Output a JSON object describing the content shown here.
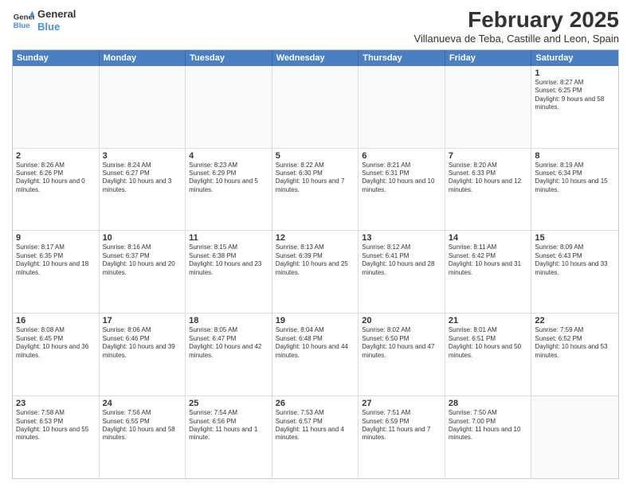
{
  "logo": {
    "line1": "General",
    "line2": "Blue"
  },
  "title": "February 2025",
  "subtitle": "Villanueva de Teba, Castille and Leon, Spain",
  "header_days": [
    "Sunday",
    "Monday",
    "Tuesday",
    "Wednesday",
    "Thursday",
    "Friday",
    "Saturday"
  ],
  "weeks": [
    [
      {
        "day": "",
        "text": ""
      },
      {
        "day": "",
        "text": ""
      },
      {
        "day": "",
        "text": ""
      },
      {
        "day": "",
        "text": ""
      },
      {
        "day": "",
        "text": ""
      },
      {
        "day": "",
        "text": ""
      },
      {
        "day": "1",
        "text": "Sunrise: 8:27 AM\nSunset: 6:25 PM\nDaylight: 9 hours and 58 minutes."
      }
    ],
    [
      {
        "day": "2",
        "text": "Sunrise: 8:26 AM\nSunset: 6:26 PM\nDaylight: 10 hours and 0 minutes."
      },
      {
        "day": "3",
        "text": "Sunrise: 8:24 AM\nSunset: 6:27 PM\nDaylight: 10 hours and 3 minutes."
      },
      {
        "day": "4",
        "text": "Sunrise: 8:23 AM\nSunset: 6:29 PM\nDaylight: 10 hours and 5 minutes."
      },
      {
        "day": "5",
        "text": "Sunrise: 8:22 AM\nSunset: 6:30 PM\nDaylight: 10 hours and 7 minutes."
      },
      {
        "day": "6",
        "text": "Sunrise: 8:21 AM\nSunset: 6:31 PM\nDaylight: 10 hours and 10 minutes."
      },
      {
        "day": "7",
        "text": "Sunrise: 8:20 AM\nSunset: 6:33 PM\nDaylight: 10 hours and 12 minutes."
      },
      {
        "day": "8",
        "text": "Sunrise: 8:19 AM\nSunset: 6:34 PM\nDaylight: 10 hours and 15 minutes."
      }
    ],
    [
      {
        "day": "9",
        "text": "Sunrise: 8:17 AM\nSunset: 6:35 PM\nDaylight: 10 hours and 18 minutes."
      },
      {
        "day": "10",
        "text": "Sunrise: 8:16 AM\nSunset: 6:37 PM\nDaylight: 10 hours and 20 minutes."
      },
      {
        "day": "11",
        "text": "Sunrise: 8:15 AM\nSunset: 6:38 PM\nDaylight: 10 hours and 23 minutes."
      },
      {
        "day": "12",
        "text": "Sunrise: 8:13 AM\nSunset: 6:39 PM\nDaylight: 10 hours and 25 minutes."
      },
      {
        "day": "13",
        "text": "Sunrise: 8:12 AM\nSunset: 6:41 PM\nDaylight: 10 hours and 28 minutes."
      },
      {
        "day": "14",
        "text": "Sunrise: 8:11 AM\nSunset: 6:42 PM\nDaylight: 10 hours and 31 minutes."
      },
      {
        "day": "15",
        "text": "Sunrise: 8:09 AM\nSunset: 6:43 PM\nDaylight: 10 hours and 33 minutes."
      }
    ],
    [
      {
        "day": "16",
        "text": "Sunrise: 8:08 AM\nSunset: 6:45 PM\nDaylight: 10 hours and 36 minutes."
      },
      {
        "day": "17",
        "text": "Sunrise: 8:06 AM\nSunset: 6:46 PM\nDaylight: 10 hours and 39 minutes."
      },
      {
        "day": "18",
        "text": "Sunrise: 8:05 AM\nSunset: 6:47 PM\nDaylight: 10 hours and 42 minutes."
      },
      {
        "day": "19",
        "text": "Sunrise: 8:04 AM\nSunset: 6:48 PM\nDaylight: 10 hours and 44 minutes."
      },
      {
        "day": "20",
        "text": "Sunrise: 8:02 AM\nSunset: 6:50 PM\nDaylight: 10 hours and 47 minutes."
      },
      {
        "day": "21",
        "text": "Sunrise: 8:01 AM\nSunset: 6:51 PM\nDaylight: 10 hours and 50 minutes."
      },
      {
        "day": "22",
        "text": "Sunrise: 7:59 AM\nSunset: 6:52 PM\nDaylight: 10 hours and 53 minutes."
      }
    ],
    [
      {
        "day": "23",
        "text": "Sunrise: 7:58 AM\nSunset: 6:53 PM\nDaylight: 10 hours and 55 minutes."
      },
      {
        "day": "24",
        "text": "Sunrise: 7:56 AM\nSunset: 6:55 PM\nDaylight: 10 hours and 58 minutes."
      },
      {
        "day": "25",
        "text": "Sunrise: 7:54 AM\nSunset: 6:56 PM\nDaylight: 11 hours and 1 minute."
      },
      {
        "day": "26",
        "text": "Sunrise: 7:53 AM\nSunset: 6:57 PM\nDaylight: 11 hours and 4 minutes."
      },
      {
        "day": "27",
        "text": "Sunrise: 7:51 AM\nSunset: 6:59 PM\nDaylight: 11 hours and 7 minutes."
      },
      {
        "day": "28",
        "text": "Sunrise: 7:50 AM\nSunset: 7:00 PM\nDaylight: 11 hours and 10 minutes."
      },
      {
        "day": "",
        "text": ""
      }
    ]
  ]
}
